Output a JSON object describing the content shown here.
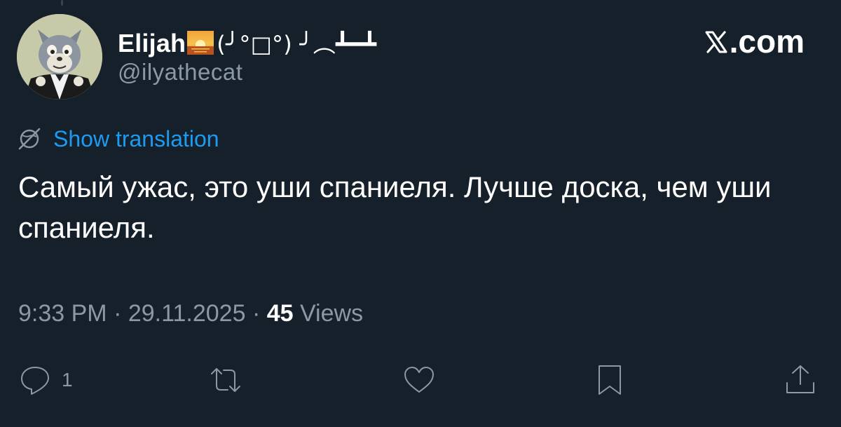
{
  "tweet": {
    "author": {
      "display_name": "Elijah",
      "name_emoticon": "(╯°□°) ╯︵┻━┻",
      "handle": "@ilyathecat",
      "avatar_icon": "cartoon-cat-avatar"
    },
    "brand": {
      "label": ".com",
      "icon": "x-logo-icon"
    },
    "translate": {
      "label": "Show translation",
      "icon": "globe-slash-icon"
    },
    "text": "Самый ужас, это уши спаниеля. Лучше доска, чем уши спаниеля.",
    "meta": {
      "time": "9:33 PM",
      "separator_1": " · ",
      "date": "29.11.2025",
      "separator_2": " · ",
      "views_count": "45",
      "views_label": " Views"
    },
    "actions": {
      "reply": {
        "icon": "reply-icon",
        "count": "1"
      },
      "retweet": {
        "icon": "retweet-icon",
        "count": ""
      },
      "like": {
        "icon": "heart-icon",
        "count": ""
      },
      "bookmark": {
        "icon": "bookmark-icon",
        "count": ""
      },
      "share": {
        "icon": "share-icon",
        "count": ""
      }
    }
  },
  "colors": {
    "background": "#15202b",
    "primary_text": "#ffffff",
    "secondary_text": "#8b98a5",
    "link": "#1d9bf0"
  }
}
